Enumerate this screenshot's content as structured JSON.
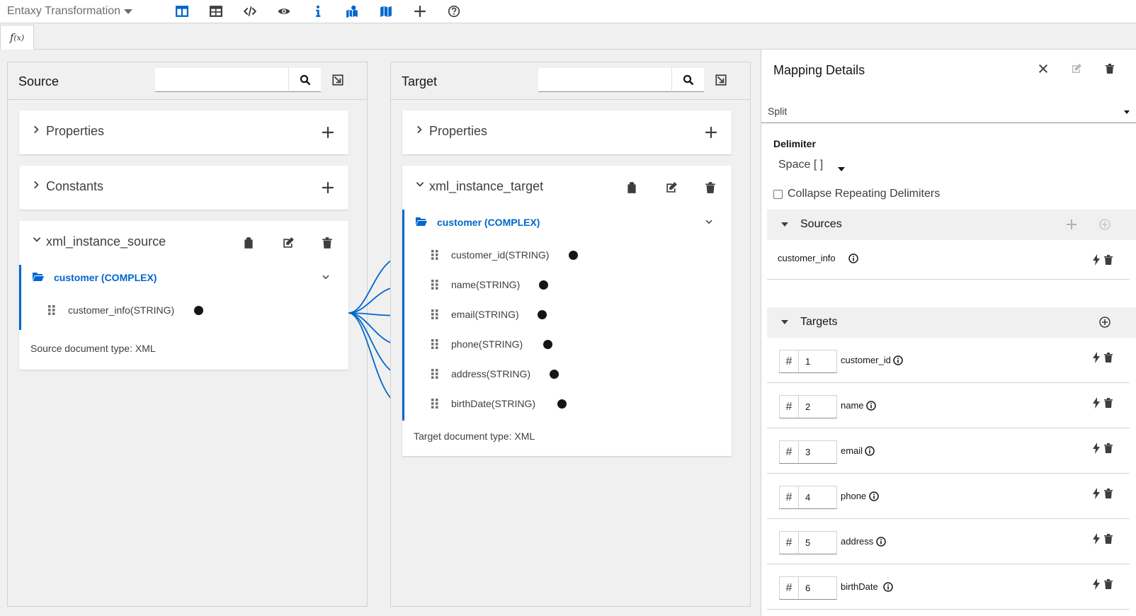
{
  "app": {
    "title": "Entaxy Transformation",
    "toolbar_icons": [
      "columns-icon",
      "table-icon",
      "code-icon",
      "eye-icon",
      "info-icon",
      "map-marked-icon",
      "map-icon",
      "plus-icon",
      "help-icon"
    ],
    "accent_color": "#0066cc"
  },
  "tabs": {
    "fx_label": "f",
    "fx_sub": "(x)"
  },
  "source": {
    "title": "Source",
    "search_placeholder": "",
    "properties_label": "Properties",
    "constants_label": "Constants",
    "document_name": "xml_instance_source",
    "node_label": "customer (COMPLEX)",
    "fields": [
      "customer_info(STRING)"
    ],
    "doc_type": "Source document type: XML"
  },
  "target": {
    "title": "Target",
    "search_placeholder": "",
    "properties_label": "Properties",
    "document_name": "xml_instance_target",
    "node_label": "customer (COMPLEX)",
    "fields": [
      "customer_id(STRING)",
      "name(STRING)",
      "email(STRING)",
      "phone(STRING)",
      "address(STRING)",
      "birthDate(STRING)"
    ],
    "doc_type": "Target document type: XML"
  },
  "details": {
    "title": "Mapping Details",
    "function": "Split",
    "delimiter_label": "Delimiter",
    "delimiter_value": "Space [ ]",
    "collapse_label": "Collapse Repeating Delimiters",
    "collapse_checked": false,
    "sources_title": "Sources",
    "sources": [
      {
        "name": "customer_info"
      }
    ],
    "targets_title": "Targets",
    "targets": [
      {
        "index": "1",
        "name": "customer_id"
      },
      {
        "index": "2",
        "name": "name"
      },
      {
        "index": "3",
        "name": "email"
      },
      {
        "index": "4",
        "name": "phone"
      },
      {
        "index": "5",
        "name": "address"
      },
      {
        "index": "6",
        "name": "birthDate"
      }
    ],
    "hash_symbol": "#"
  }
}
